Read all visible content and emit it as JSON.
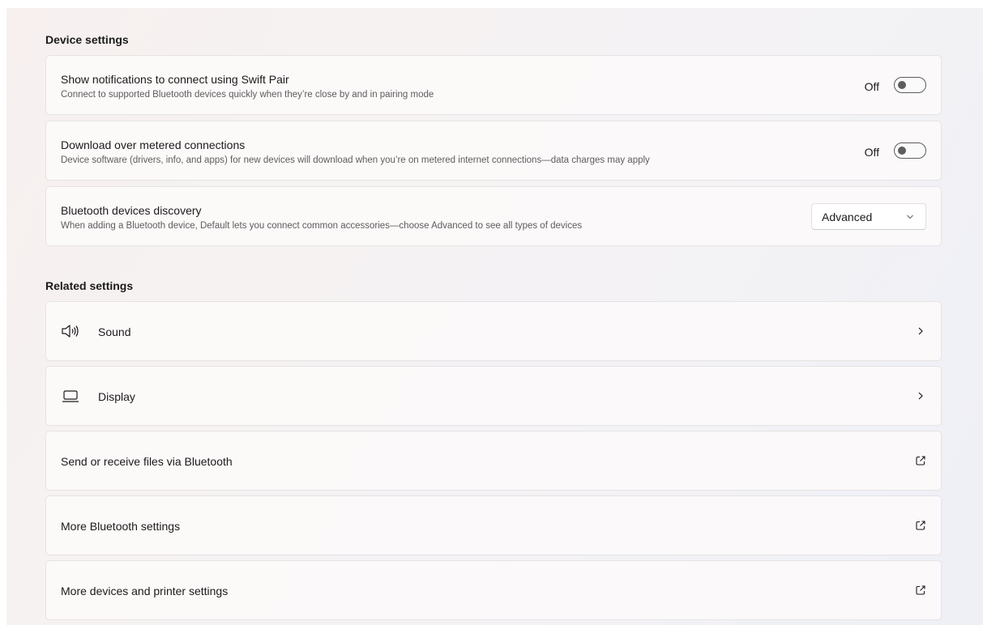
{
  "device_settings": {
    "heading": "Device settings",
    "rows": [
      {
        "title": "Show notifications to connect using Swift Pair",
        "description": "Connect to supported Bluetooth devices quickly when they’re close by and in pairing mode",
        "toggle_label": "Off",
        "toggle_state": "off"
      },
      {
        "title": "Download over metered connections",
        "description": "Device software (drivers, info, and apps) for new devices will download when you’re on metered internet connections—data charges may apply",
        "toggle_label": "Off",
        "toggle_state": "off"
      },
      {
        "title": "Bluetooth devices discovery",
        "description": "When adding a Bluetooth device, Default lets you connect common accessories—choose Advanced to see all types of devices",
        "dropdown_value": "Advanced"
      }
    ]
  },
  "related_settings": {
    "heading": "Related settings",
    "items": [
      {
        "label": "Sound",
        "icon": "speaker-icon",
        "trailing_icon": "chevron-right-icon"
      },
      {
        "label": "Display",
        "icon": "laptop-icon",
        "trailing_icon": "chevron-right-icon"
      },
      {
        "label": "Send or receive files via Bluetooth",
        "trailing_icon": "open-external-icon"
      },
      {
        "label": "More Bluetooth settings",
        "trailing_icon": "open-external-icon"
      },
      {
        "label": "More devices and printer settings",
        "trailing_icon": "open-external-icon"
      }
    ]
  }
}
